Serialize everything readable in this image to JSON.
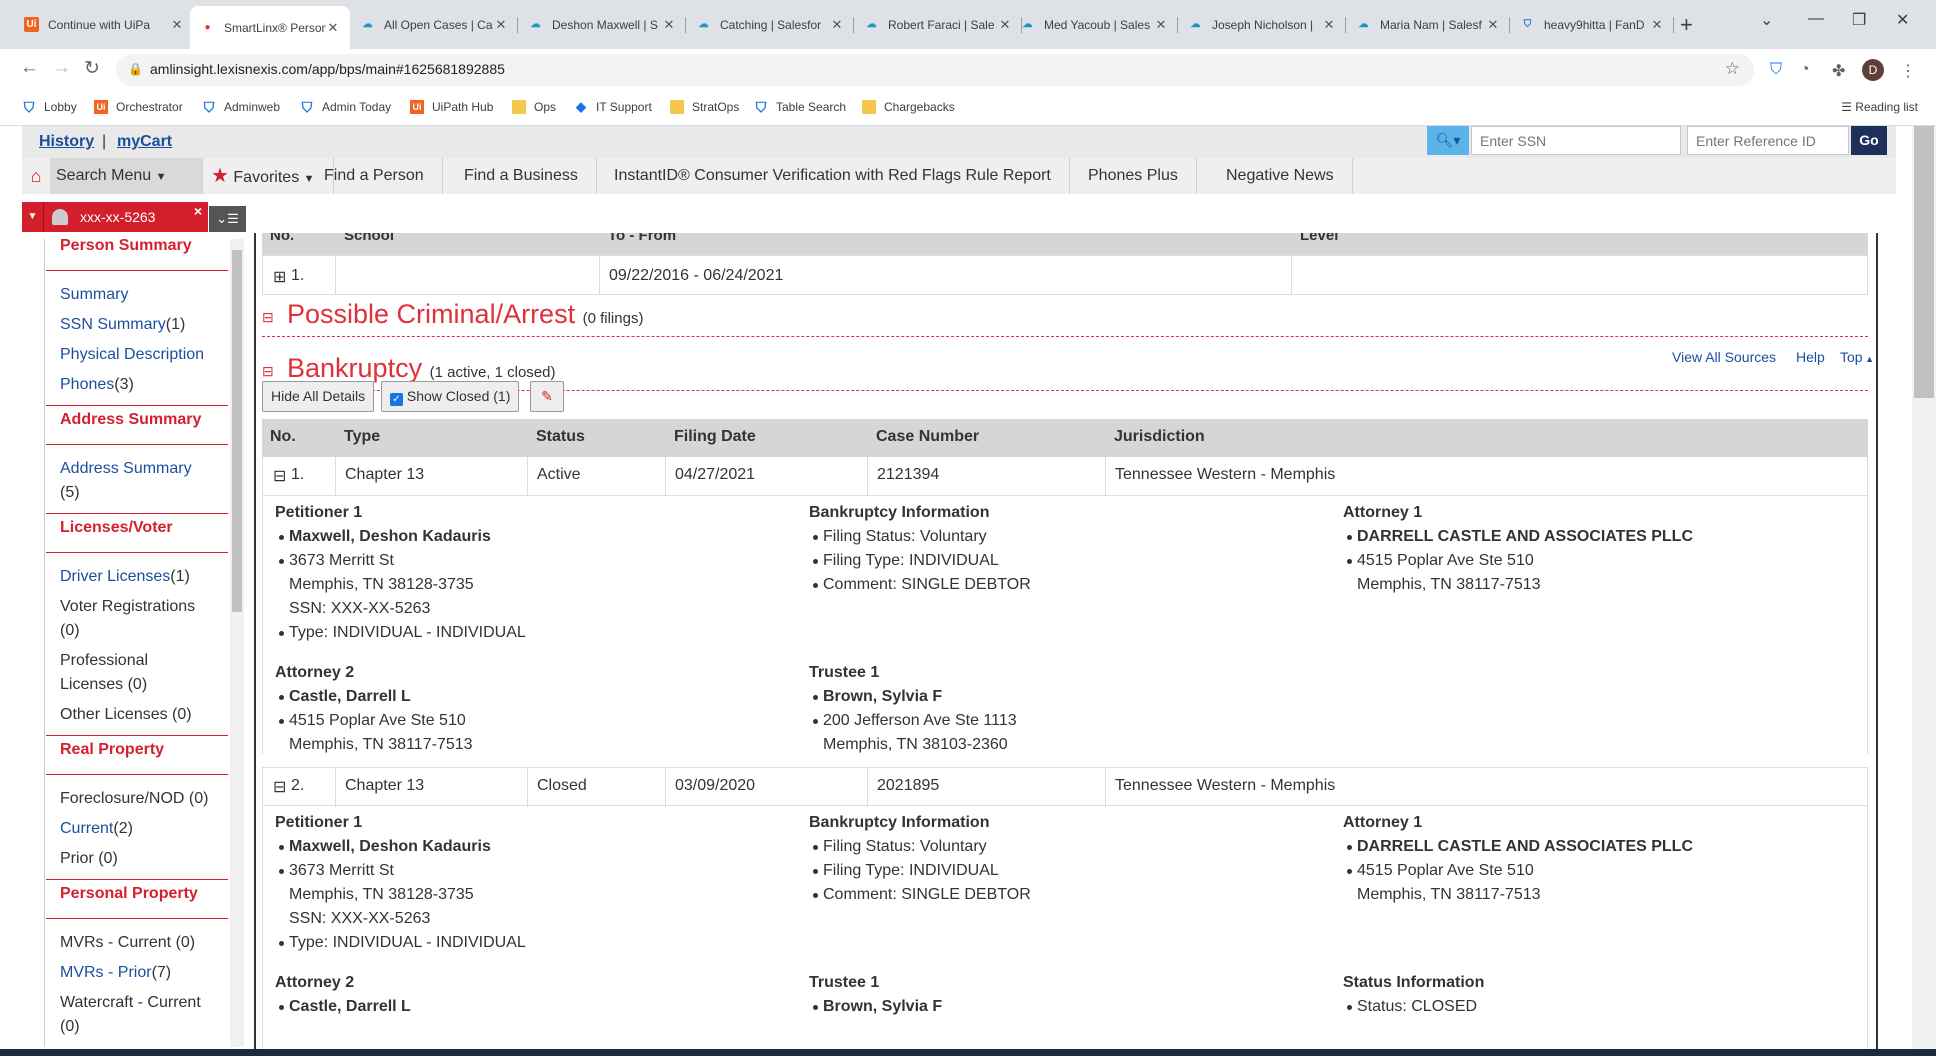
{
  "browser": {
    "tabs": [
      {
        "title": "Continue with UiPa",
        "icon": "uipath-icon"
      },
      {
        "title": "SmartLinx® Person",
        "icon": "lexis-icon"
      },
      {
        "title": "All Open Cases | Ca",
        "icon": "salesforce-icon"
      },
      {
        "title": "Deshon Maxwell | S",
        "icon": "salesforce-icon"
      },
      {
        "title": "Catching | Salesfor",
        "icon": "salesforce-icon"
      },
      {
        "title": "Robert Faraci | Sale",
        "icon": "salesforce-icon"
      },
      {
        "title": "Med Yacoub | Sales",
        "icon": "salesforce-icon"
      },
      {
        "title": "Joseph Nicholson |",
        "icon": "salesforce-icon"
      },
      {
        "title": "Maria Nam | Salesf",
        "icon": "salesforce-icon"
      },
      {
        "title": "heavy9hitta | FanD",
        "icon": "shield-icon"
      }
    ],
    "url": "amlinsight.lexisnexis.com/app/bps/main#1625681892885",
    "avatar_letter": "D",
    "bookmarks": [
      {
        "label": "Lobby",
        "icon": "shield-icon"
      },
      {
        "label": "Orchestrator",
        "icon": "uipath-icon"
      },
      {
        "label": "Adminweb",
        "icon": "shield-icon"
      },
      {
        "label": "Admin Today",
        "icon": "shield-icon"
      },
      {
        "label": "UiPath Hub",
        "icon": "uipath-icon"
      },
      {
        "label": "Ops",
        "icon": "folder-icon"
      },
      {
        "label": "IT Support",
        "icon": "diamond-icon"
      },
      {
        "label": "StratOps",
        "icon": "folder-icon"
      },
      {
        "label": "Table Search",
        "icon": "shield-icon"
      },
      {
        "label": "Chargebacks",
        "icon": "folder-icon"
      }
    ],
    "reading_list": "Reading list"
  },
  "topbar": {
    "history": "History",
    "separator": "|",
    "mycart": "myCart",
    "ssn_placeholder": "Enter SSN",
    "ref_placeholder": "Enter Reference ID",
    "go": "Go"
  },
  "menu": {
    "search_menu": "Search Menu",
    "favorites": "Favorites",
    "items": [
      "Find a Person",
      "Find a Business",
      "InstantID® Consumer Verification with Red Flags Rule Report",
      "Phones Plus",
      "Negative News"
    ]
  },
  "context_tab": {
    "label": "xxx-xx-5263"
  },
  "sidebar": {
    "person_summary": "Person Summary",
    "summary": "Summary",
    "ssn_summary": "SSN Summary",
    "ssn_count": "(1)",
    "physical_description": "Physical Description",
    "phones": "Phones",
    "phones_count": "(3)",
    "address_summary_header": "Address Summary",
    "address_summary": "Address Summary",
    "address_count": "(5)",
    "licenses_voter": "Licenses/Voter",
    "driver_licenses": "Driver Licenses",
    "driver_count": "(1)",
    "voter_registrations": "Voter Registrations",
    "voter_count": "(0)",
    "professional": "Professional",
    "professional_licenses": "Licenses (0)",
    "other_licenses": "Other Licenses (0)",
    "real_property": "Real Property",
    "foreclosure": "Foreclosure/NOD (0)",
    "current": "Current",
    "current_count": "(2)",
    "prior": "Prior (0)",
    "personal_property": "Personal Property",
    "mvrs_current": "MVRs - Current (0)",
    "mvrs_prior": "MVRs - Prior",
    "mvrs_prior_count": "(7)",
    "watercraft": "Watercraft - Current",
    "watercraft_count": "(0)"
  },
  "education_partial": {
    "headers": [
      "No.",
      "School",
      "To - From",
      "Level"
    ],
    "row": {
      "no": "1.",
      "dates": "09/22/2016 - 06/24/2021"
    }
  },
  "criminal": {
    "title": "Possible Criminal/Arrest",
    "sub": "(0 filings)"
  },
  "bankruptcy": {
    "title": "Bankruptcy",
    "sub": "(1 active, 1 closed)",
    "links": {
      "view_all": "View All Sources",
      "help": "Help",
      "top": "Top"
    },
    "hide_all": "Hide All Details",
    "show_closed": "Show Closed (1)",
    "columns": [
      "No.",
      "Type",
      "Status",
      "Filing Date",
      "Case Number",
      "Jurisdiction"
    ],
    "rows": [
      {
        "no": "1.",
        "type": "Chapter 13",
        "status": "Active",
        "filing_date": "04/27/2021",
        "case_number": "2121394",
        "jurisdiction": "Tennessee Western - Memphis",
        "petitioner": {
          "heading": "Petitioner 1",
          "name": "Maxwell, Deshon Kadauris",
          "street": "3673 Merritt St",
          "city": "Memphis, TN 38128-3735",
          "ssn": "SSN: XXX-XX-5263",
          "type": "Type: INDIVIDUAL - INDIVIDUAL"
        },
        "info": {
          "heading": "Bankruptcy Information",
          "status": "Filing Status: Voluntary",
          "type": "Filing Type: INDIVIDUAL",
          "comment": "Comment: SINGLE DEBTOR"
        },
        "attorney1": {
          "heading": "Attorney 1",
          "name": "DARRELL CASTLE AND ASSOCIATES PLLC",
          "street": "4515 Poplar Ave Ste 510",
          "city": "Memphis, TN 38117-7513"
        },
        "attorney2": {
          "heading": "Attorney 2",
          "name": "Castle, Darrell L",
          "street": "4515 Poplar Ave Ste 510",
          "city": "Memphis, TN 38117-7513"
        },
        "trustee": {
          "heading": "Trustee 1",
          "name": "Brown, Sylvia F",
          "street": "200 Jefferson Ave Ste 1113",
          "city": "Memphis, TN 38103-2360"
        }
      },
      {
        "no": "2.",
        "type": "Chapter 13",
        "status": "Closed",
        "filing_date": "03/09/2020",
        "case_number": "2021895",
        "jurisdiction": "Tennessee Western - Memphis",
        "petitioner": {
          "heading": "Petitioner 1",
          "name": "Maxwell, Deshon Kadauris",
          "street": "3673 Merritt St",
          "city": "Memphis, TN 38128-3735",
          "ssn": "SSN: XXX-XX-5263",
          "type": "Type: INDIVIDUAL - INDIVIDUAL"
        },
        "info": {
          "heading": "Bankruptcy Information",
          "status": "Filing Status: Voluntary",
          "type": "Filing Type: INDIVIDUAL",
          "comment": "Comment: SINGLE DEBTOR"
        },
        "attorney1": {
          "heading": "Attorney 1",
          "name": "DARRELL CASTLE AND ASSOCIATES PLLC",
          "street": "4515 Poplar Ave Ste 510",
          "city": "Memphis, TN 38117-7513"
        },
        "attorney2": {
          "heading": "Attorney 2",
          "name": "Castle, Darrell L"
        },
        "trustee": {
          "heading": "Trustee 1",
          "name": "Brown, Sylvia F"
        },
        "status_info": {
          "heading": "Status Information",
          "status": "Status: CLOSED"
        }
      }
    ]
  },
  "colors": {
    "accent_red": "#d42030",
    "link_blue": "#1b4f9c",
    "header_gray": "#d6d6d6"
  }
}
